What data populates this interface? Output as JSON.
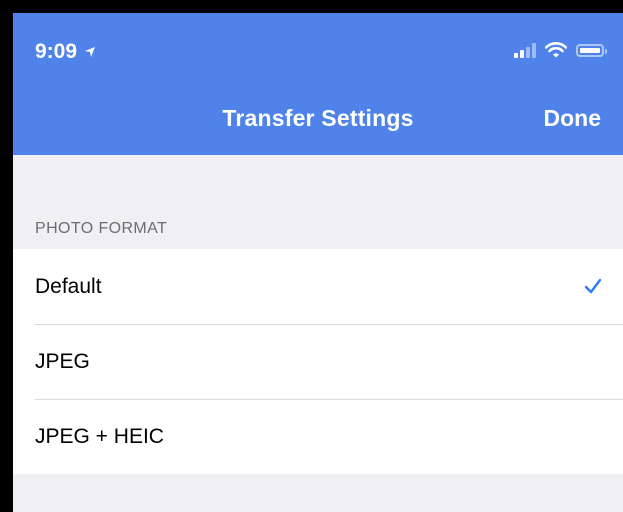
{
  "status_bar": {
    "time": "9:09",
    "icons": [
      "location-arrow-icon",
      "signal-icon",
      "wifi-icon",
      "battery-icon"
    ]
  },
  "nav": {
    "title": "Transfer Settings",
    "done_label": "Done"
  },
  "photo_format": {
    "section_title": "PHOTO FORMAT",
    "options": [
      {
        "label": "Default",
        "selected": true
      },
      {
        "label": "JPEG",
        "selected": false
      },
      {
        "label": "JPEG + HEIC",
        "selected": false
      }
    ]
  },
  "colors": {
    "header_bg": "#5083ea",
    "accent": "#2f7cf6",
    "page_bg": "#efeff4"
  }
}
